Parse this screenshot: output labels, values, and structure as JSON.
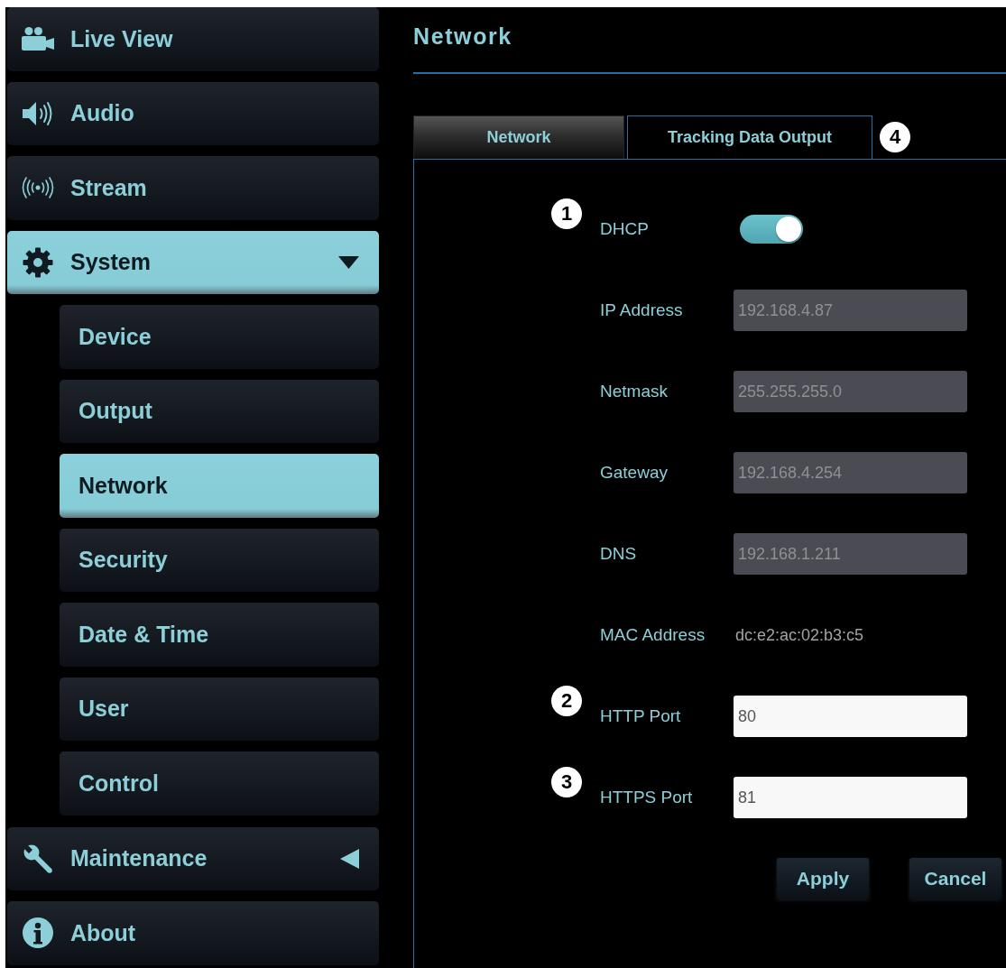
{
  "sidebar": {
    "items": [
      {
        "label": "Live View",
        "selected": false
      },
      {
        "label": "Audio",
        "selected": false
      },
      {
        "label": "Stream",
        "selected": false
      },
      {
        "label": "System",
        "selected": true,
        "expanded": true,
        "children": [
          {
            "label": "Device",
            "selected": false
          },
          {
            "label": "Output",
            "selected": false
          },
          {
            "label": "Network",
            "selected": true
          },
          {
            "label": "Security",
            "selected": false
          },
          {
            "label": "Date & Time",
            "selected": false
          },
          {
            "label": "User",
            "selected": false
          },
          {
            "label": "Control",
            "selected": false
          }
        ]
      },
      {
        "label": "Maintenance",
        "selected": false,
        "expanded": false
      },
      {
        "label": "About",
        "selected": false
      }
    ]
  },
  "page": {
    "title": "Network"
  },
  "tabs": [
    {
      "label": "Network",
      "selected": true
    },
    {
      "label": "Tracking Data Output",
      "selected": false,
      "callout": "4"
    }
  ],
  "form": {
    "rows": [
      {
        "kind": "toggle",
        "label": "DHCP",
        "on": true,
        "callout": "1"
      },
      {
        "kind": "field",
        "label": "IP Address",
        "value": "192.168.4.87",
        "disabled": true
      },
      {
        "kind": "field",
        "label": "Netmask",
        "value": "255.255.255.0",
        "disabled": true
      },
      {
        "kind": "field",
        "label": "Gateway",
        "value": "192.168.4.254",
        "disabled": true
      },
      {
        "kind": "field",
        "label": "DNS",
        "value": "192.168.1.211",
        "disabled": true
      },
      {
        "kind": "text",
        "label": "MAC Address",
        "value": "dc:e2:ac:02:b3:c5"
      },
      {
        "kind": "field",
        "label": "HTTP Port",
        "value": "80",
        "disabled": false,
        "callout": "2"
      },
      {
        "kind": "field",
        "label": "HTTPS Port",
        "value": "81",
        "disabled": false,
        "callout": "3"
      }
    ]
  },
  "buttons": [
    {
      "label": "Apply"
    },
    {
      "label": "Cancel"
    }
  ]
}
